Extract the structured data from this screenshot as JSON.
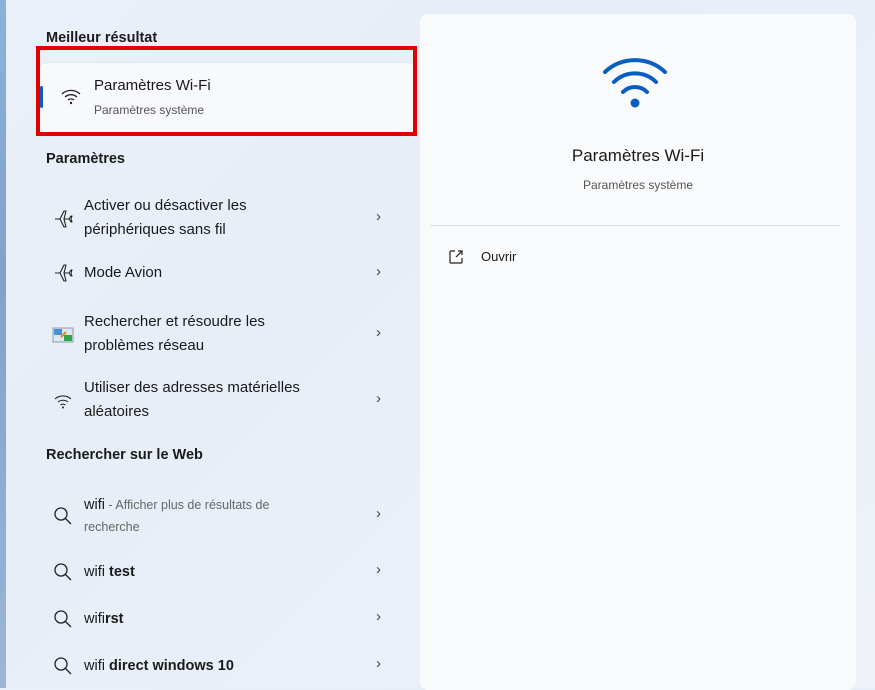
{
  "left": {
    "best_match_heading": "Meilleur résultat",
    "best_match": {
      "title": "Paramètres Wi-Fi",
      "subtitle": "Paramètres système",
      "icon": "wifi-icon"
    },
    "settings_heading": "Paramètres",
    "settings": [
      {
        "line1": "Activer ou désactiver les",
        "line2": "périphériques sans fil",
        "icon": "airplane-icon"
      },
      {
        "line1": "Mode Avion",
        "icon": "airplane-icon"
      },
      {
        "line1": "Rechercher et résoudre les",
        "line2": "problèmes réseau",
        "icon": "network-troubleshoot-icon"
      },
      {
        "line1": "Utiliser des adresses matérielles",
        "line2": "aléatoires",
        "icon": "wifi-icon"
      }
    ],
    "web_heading": "Rechercher sur le Web",
    "web": [
      {
        "term": "wifi",
        "hint": " - Afficher plus de résultats de",
        "hint2": "recherche"
      },
      {
        "prefix": "wifi ",
        "bold": "test"
      },
      {
        "prefix": "wifi",
        "bold": "rst"
      },
      {
        "prefix": "wifi ",
        "bold": "direct windows 10"
      }
    ],
    "chevron": "›"
  },
  "right": {
    "title": "Paramètres Wi-Fi",
    "subtitle": "Paramètres système",
    "open_label": "Ouvrir",
    "accent_color": "#0a5ec2"
  }
}
